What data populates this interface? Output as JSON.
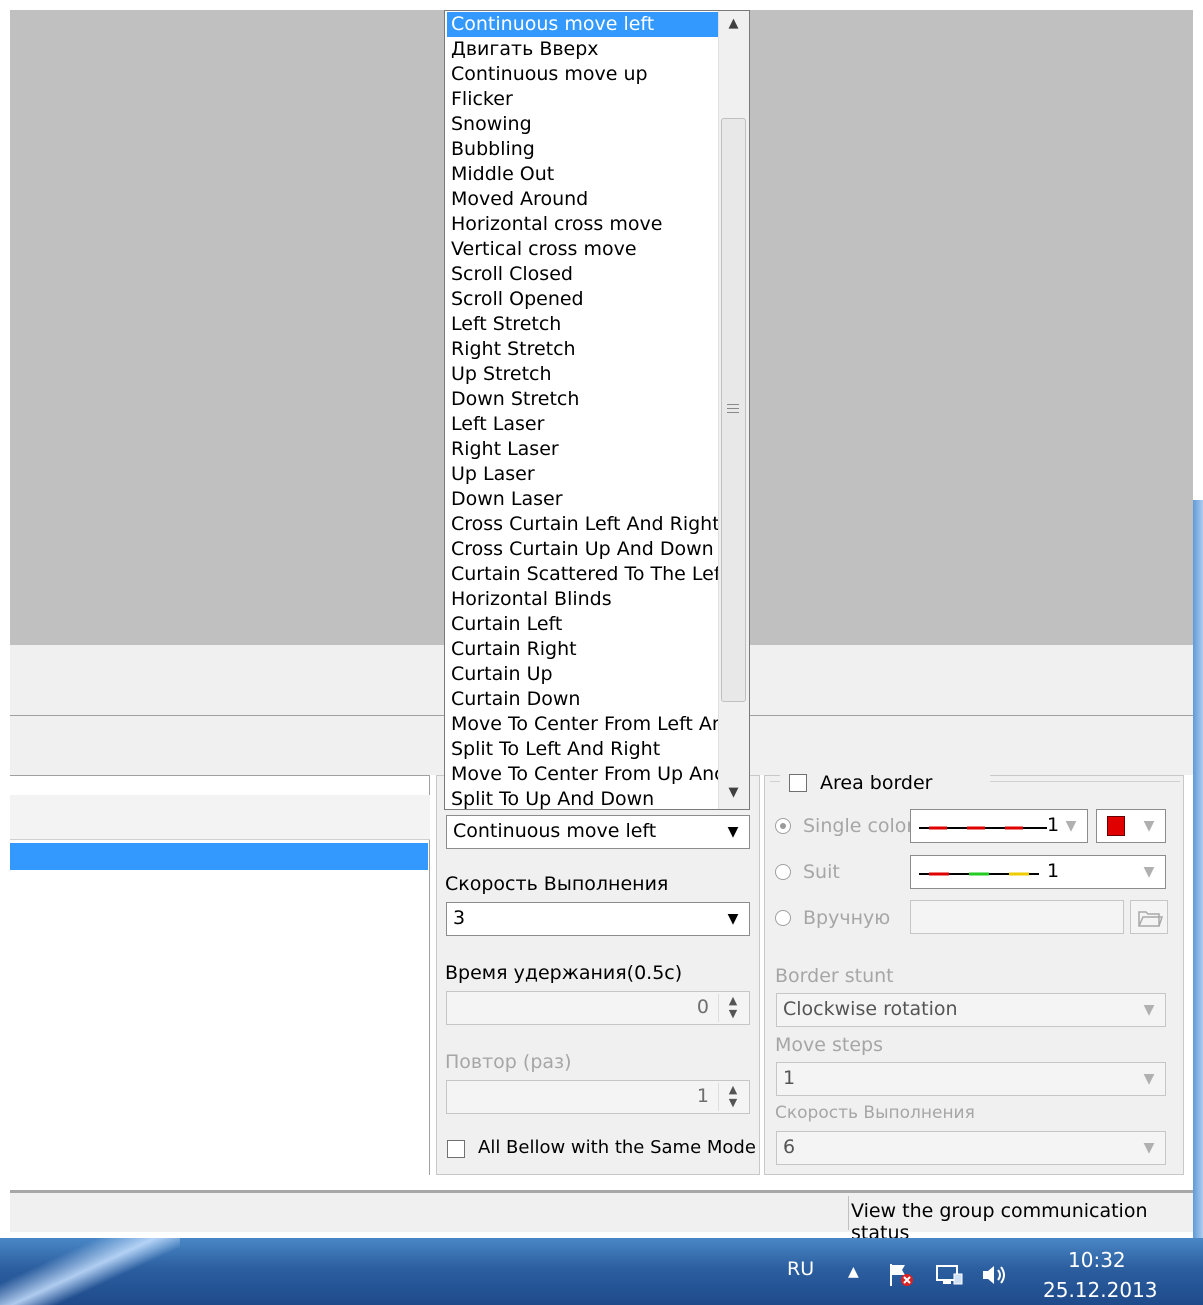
{
  "dropdown": {
    "items": [
      "Continuous move left",
      "Двигать Вверх",
      "Continuous move up",
      "Flicker",
      "Snowing",
      "Bubbling",
      "Middle Out",
      "Moved Around",
      "Horizontal cross move",
      "Vertical cross move",
      "Scroll Closed",
      "Scroll Opened",
      "Left Stretch",
      "Right Stretch",
      "Up Stretch",
      "Down Stretch",
      "Left Laser",
      "Right Laser",
      "Up Laser",
      "Down Laser",
      "Cross Curtain Left And Right",
      "Cross Curtain Up And Down",
      "Curtain Scattered To The Lef",
      "Horizontal Blinds",
      "Curtain Left",
      "Curtain Right",
      "Curtain Up",
      "Curtain Down",
      "Move To Center From Left Ar",
      "Split To Left And Right",
      "Move To Center From Up Anc",
      "Split To Up And Down"
    ],
    "selected_index": 0
  },
  "mode": {
    "effect_value": "Continuous move left",
    "speed_label": "Скорость Выполнения",
    "speed_value": "3",
    "hold_label": "Время удержания(0.5с)",
    "hold_value": "0",
    "repeat_label": "Повтор (раз)",
    "repeat_value": "1",
    "same_mode_label": "All Bellow with the Same Mode",
    "same_mode_checked": false
  },
  "border": {
    "title": "Area border",
    "enabled": false,
    "single_color_label": "Single color",
    "single_color_selected": true,
    "single_value": "1",
    "color_swatch": "#e00000",
    "suit_label": "Suit",
    "suit_value": "1",
    "manual_label": "Вручную",
    "manual_value": "",
    "stunt_label": "Border stunt",
    "stunt_value": "Clockwise rotation",
    "move_steps_label": "Move steps",
    "move_steps_value": "1",
    "speed_label": "Скорость Выполнения",
    "speed_value": "6"
  },
  "status": {
    "text": "View the group communication status"
  },
  "taskbar": {
    "language": "RU",
    "time": "10:32",
    "date": "25.12.2013"
  }
}
